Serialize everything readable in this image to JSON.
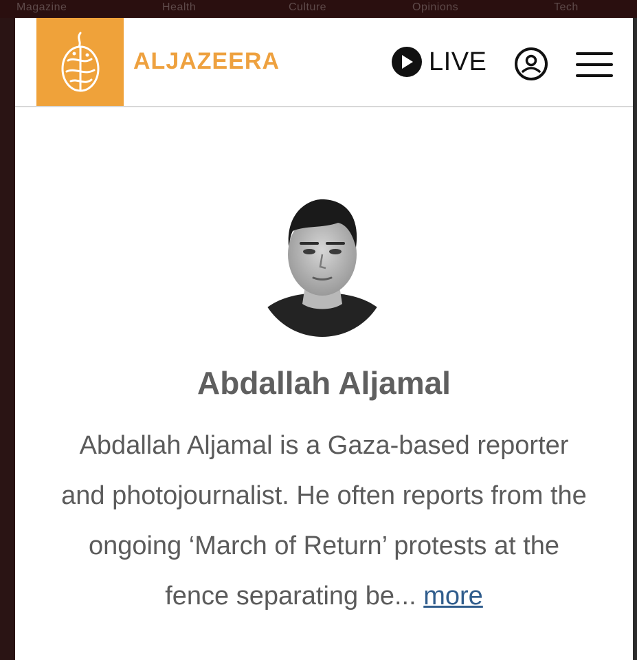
{
  "top_nav": {
    "items": [
      "Magazine",
      "Health",
      "Culture",
      "Opinions",
      "Tech"
    ]
  },
  "header": {
    "brand": "ALJAZEERA",
    "live_label": "LIVE",
    "icons": {
      "logo": "aljazeera-calligraphy-logo",
      "live": "play-icon",
      "account": "user-circle-icon",
      "menu": "hamburger-menu-icon"
    },
    "colors": {
      "brand": "#EFA23A",
      "icon": "#111111"
    }
  },
  "profile": {
    "name": "Abdallah Aljamal",
    "bio": "Abdallah Aljamal is a Gaza-based reporter and photojournalist. He often reports from the ongoing ‘March of Return’ protests at the fence separating be...",
    "more_label": "more",
    "link_color": "#2F5C8C"
  }
}
